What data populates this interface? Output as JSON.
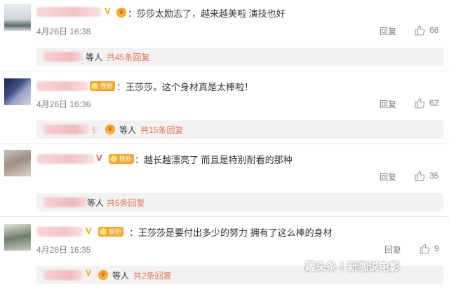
{
  "comments": [
    {
      "badge_vip": "V",
      "text": "：莎莎太励志了，越来越美啦 演技也好",
      "time": "4月26日 16:38",
      "reply_label": "回复",
      "likes": "68",
      "replies_prefix": "等人",
      "replies_link": "共45条回复"
    },
    {
      "badge_fan": "铁粉",
      "text": "：王莎莎。这个身材真是太棒啦！",
      "time": "4月26日 16:36",
      "reply_label": "回复",
      "likes": "62",
      "replies_prefix_char": "卡",
      "replies_prefix": "等人",
      "replies_link": "共15条回复"
    },
    {
      "badge_vip": "V",
      "badge_fan": "铁粉",
      "text": "：越长越漂亮了 而且是特别耐看的那种",
      "time": "",
      "reply_label": "回复",
      "likes": "35",
      "replies_prefix": "等人",
      "replies_link": "共5条回复"
    },
    {
      "badge_vip": "V",
      "badge_fan": "铁粉",
      "text": "：王莎莎是要付出多少的努力 拥有了这么棒的身材",
      "time": "4月26日 16:35",
      "reply_label": "回复",
      "likes": "9",
      "replies_vip": "V",
      "replies_prefix": "等人",
      "replies_link": "共2条回复"
    }
  ],
  "watermark": "趣头条丨新咖说电影",
  "colors": {
    "link": "#eb7350",
    "meta": "#808080",
    "badge": "#f7a52b",
    "vip": "#f6a70a"
  },
  "icons": {
    "like": "thumbs-up-icon",
    "crown": "crown-icon",
    "fan": "fan-badge-icon"
  }
}
